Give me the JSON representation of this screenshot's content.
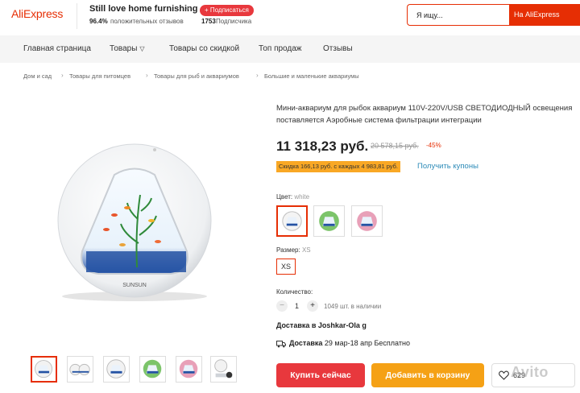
{
  "header": {
    "logo": "AliExpress",
    "store_name": "Still love home furnishing",
    "subscribe_label": "+ Подписаться",
    "rating_percent": "96.4%",
    "rating_label": "положительных отзывов",
    "subscribers_count": "1753",
    "subscribers_label": "Подписчика",
    "search": {
      "value": "Я ищу...",
      "button": "На AliExpress"
    }
  },
  "nav": {
    "items": [
      {
        "label": "Главная страница"
      },
      {
        "label": "Товары"
      },
      {
        "label": "Товары со скидкой"
      },
      {
        "label": "Топ продаж"
      },
      {
        "label": "Отзывы"
      }
    ]
  },
  "breadcrumb": [
    "Дом и сад",
    "Товары для питомцев",
    "Товары для рыб и аквариумов",
    "Большие и маленькие аквариумы"
  ],
  "product": {
    "title": "Мини-аквариум для рыбок аквариум 110V-220V/USB СВЕТОДИОДНЫЙ освещения поставляется Аэробные система фильтрации интеграции",
    "price": "11 318,23 руб.",
    "old_price": "20 578,15 руб.",
    "discount": "-45%",
    "cashback": "Скидка 166,13 руб. с каждых 4 983,81 руб.",
    "coupons_link": "Получить купоны",
    "image_brand": "SUNSUN",
    "color_label": "Цвет:",
    "color_value": "white",
    "colors": [
      {
        "accent": "#ffffff",
        "name": "white"
      },
      {
        "accent": "#7cc46a",
        "name": "green"
      },
      {
        "accent": "#e8a0b8",
        "name": "pink"
      }
    ],
    "size_label": "Размер:",
    "size_value": "XS",
    "size_option": "XS",
    "quantity_label": "Количество:",
    "quantity": "1",
    "minus": "−",
    "plus": "+",
    "stock": "1049 шт. в наличии",
    "ship_to": "Доставка в Joshkar-Ola g",
    "delivery_label": "Доставка",
    "delivery_date": "29 мар-18 апр",
    "delivery_price": "Бесплатно",
    "buy_now": "Купить сейчас",
    "add_to_cart": "Добавить в корзину",
    "wishlist_count": "629",
    "watermark": "Avito"
  },
  "colors": {
    "accent": "#e62e04",
    "buy": "#e8383d",
    "cart": "#f5a115",
    "link": "#2d8bb8",
    "cashback": "#f9a825"
  }
}
